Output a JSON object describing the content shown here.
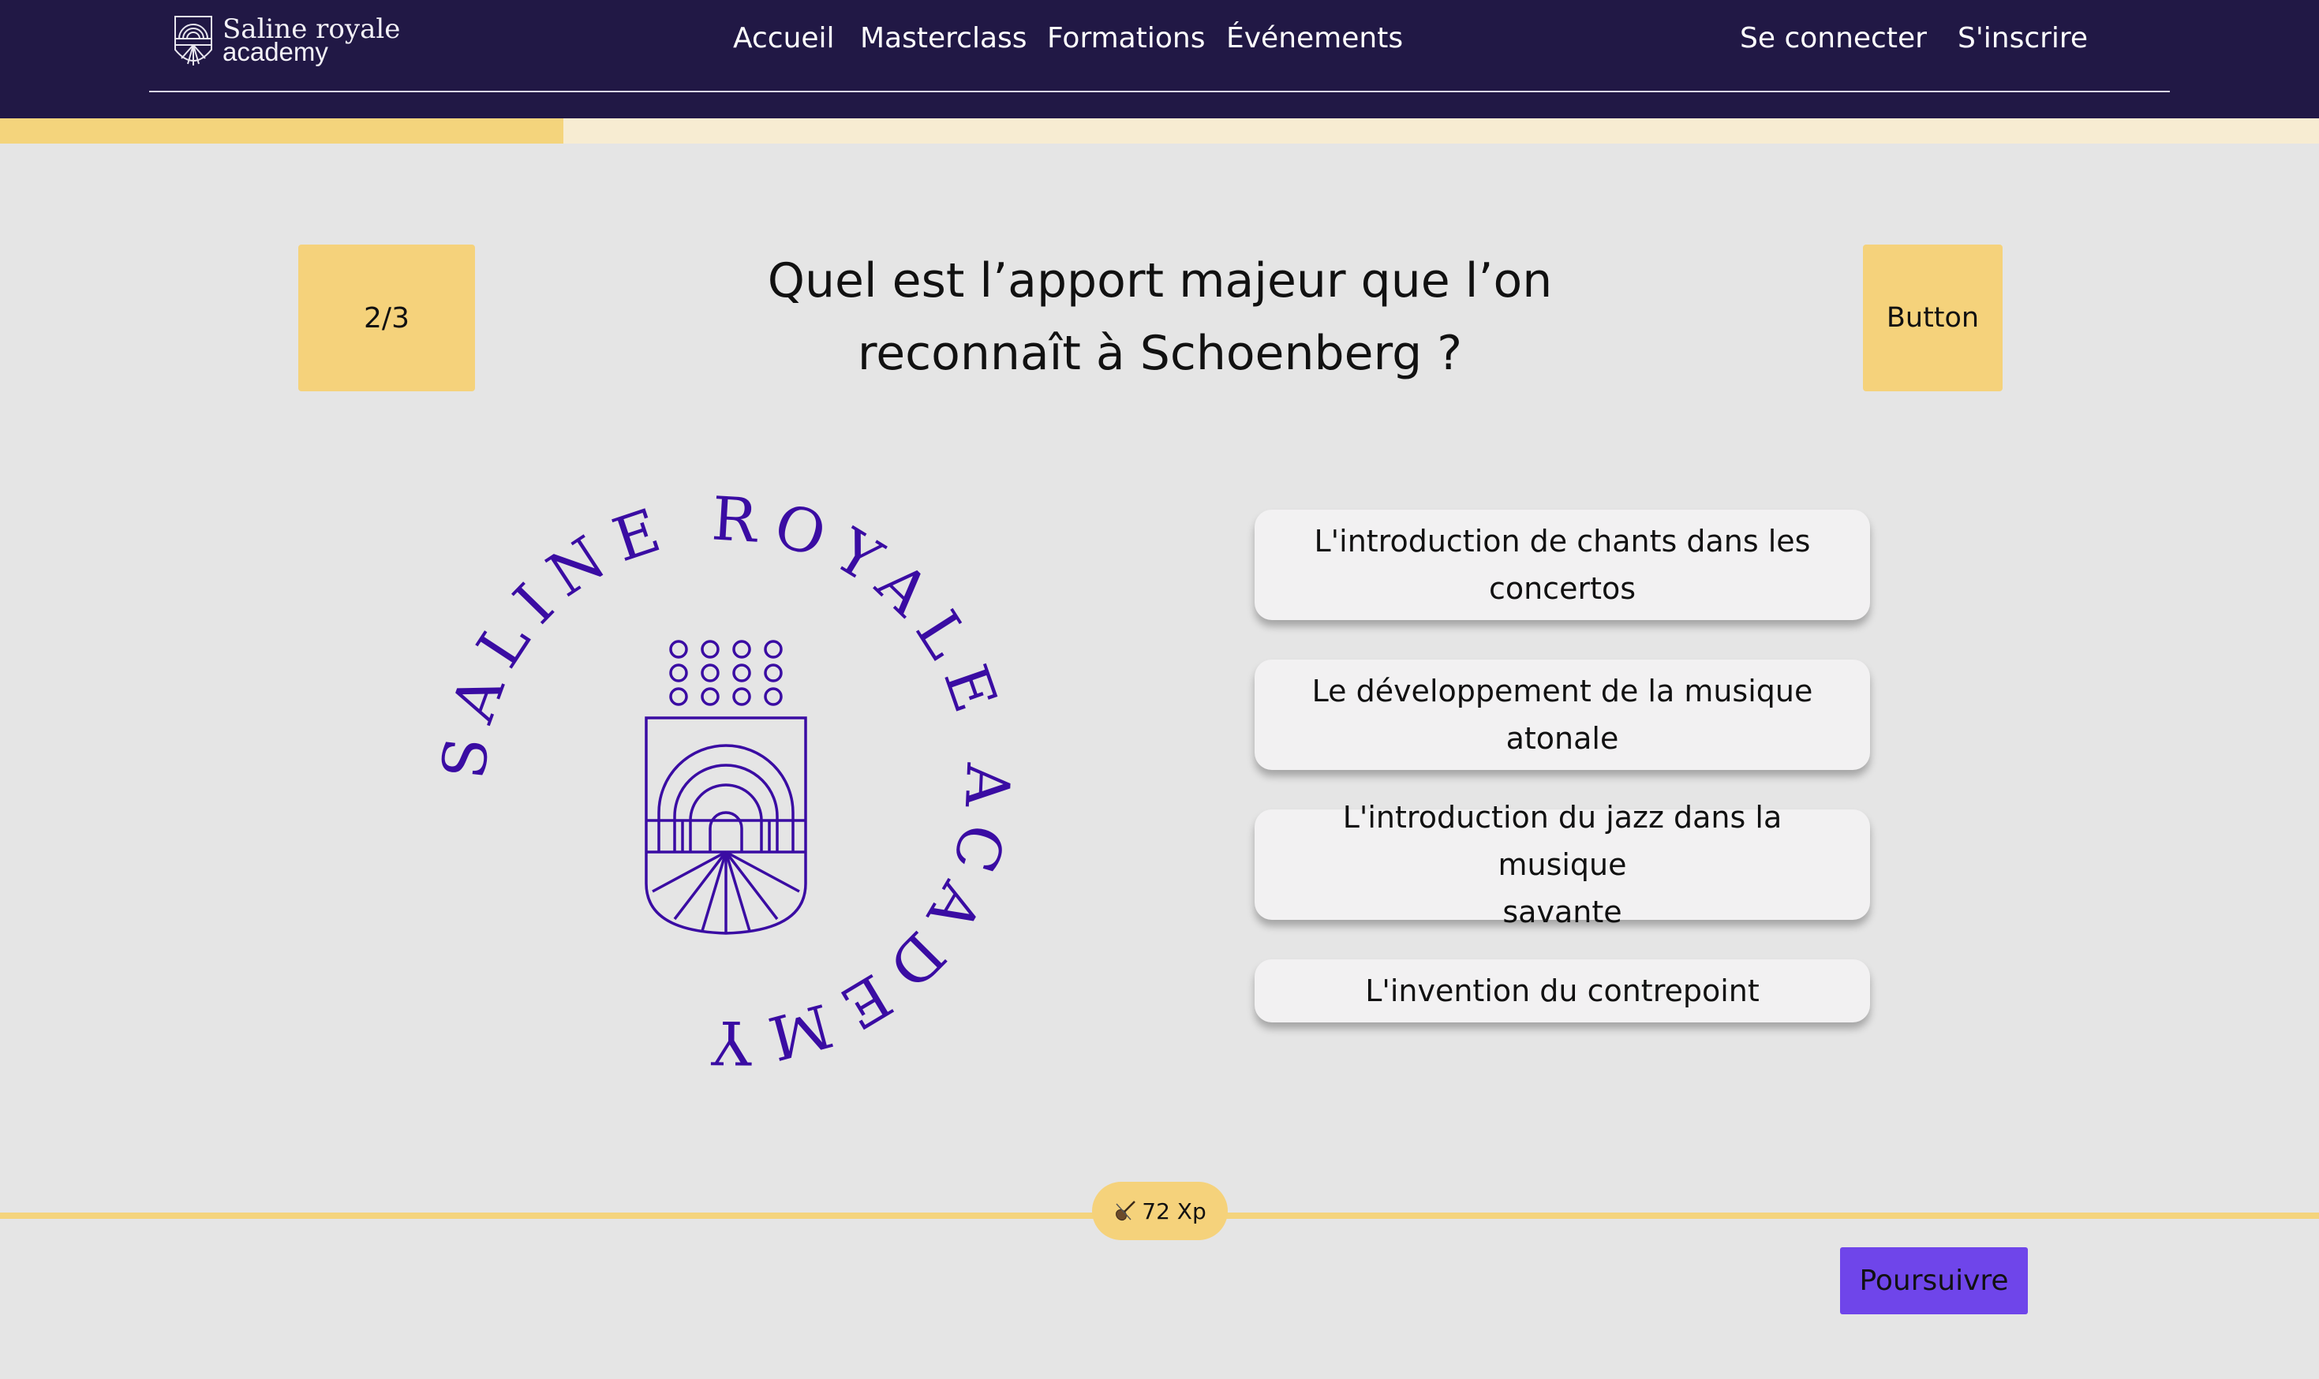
{
  "header": {
    "logo_line1": "Saline royale",
    "logo_line2": "academy",
    "nav": [
      "Accueil",
      "Masterclass",
      "Formations",
      "Événements"
    ],
    "login": "Se connecter",
    "signup": "S'inscrire"
  },
  "progress": {
    "fraction": 0.243
  },
  "quiz": {
    "counter": "2/3",
    "top_button": "Button",
    "question_line1": "Quel est l’apport majeur que l’on",
    "question_line2": "reconnaît à Schoenberg ?",
    "answers": [
      {
        "line1": "L'introduction de chants dans les",
        "line2": "concertos"
      },
      {
        "line1": "Le développement de la musique",
        "line2": "atonale"
      },
      {
        "line1": "L'introduction du jazz dans la musique",
        "line2": "savante"
      },
      {
        "line1": "L'invention du contrepoint",
        "line2": ""
      }
    ]
  },
  "emblem": {
    "ring_text": "SALINE ROYALE ACADEMY",
    "color": "#3a0ca3"
  },
  "footer": {
    "xp_label": "72 Xp",
    "continue_label": "Poursuivre"
  },
  "colors": {
    "header_bg": "#211845",
    "accent_yellow": "#f5d27b",
    "button_purple": "#6f45ea",
    "page_bg": "#e5e5e5"
  },
  "icons": {
    "xp_icon": "violin-icon"
  }
}
